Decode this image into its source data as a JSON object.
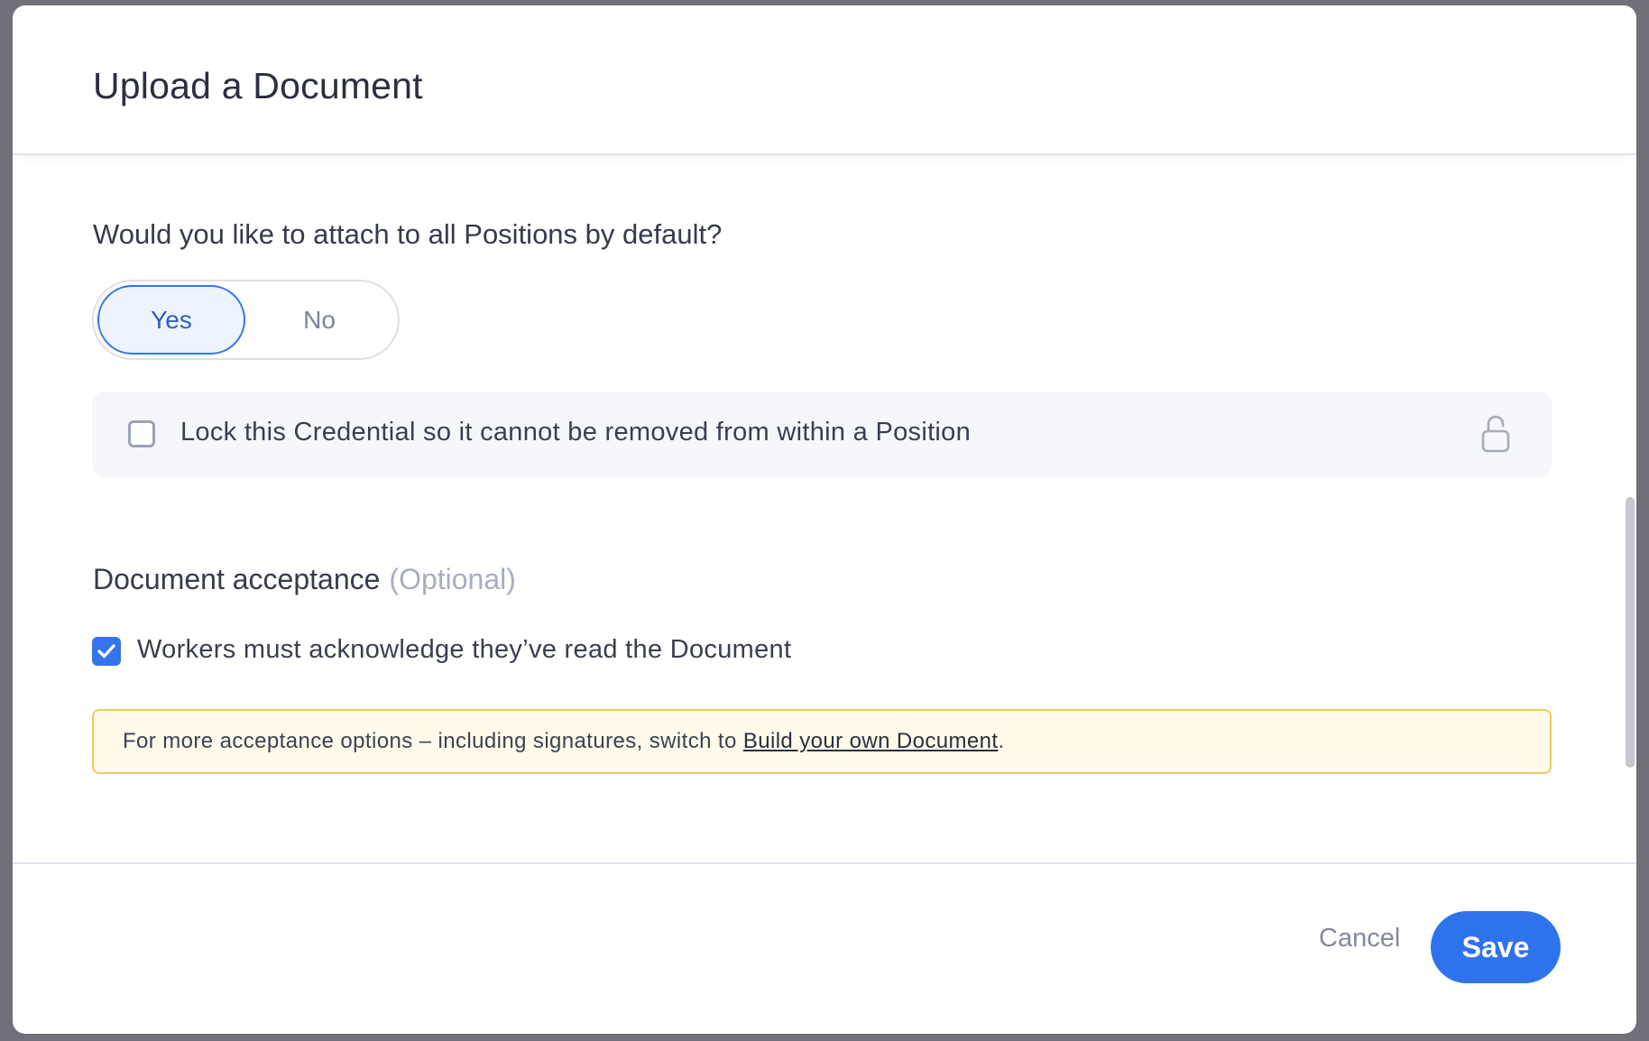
{
  "modal": {
    "title": "Upload a Document"
  },
  "attach": {
    "question": "Would you like to attach to all Positions by default?",
    "options": [
      {
        "label": "Yes",
        "selected": true
      },
      {
        "label": "No",
        "selected": false
      }
    ]
  },
  "lock": {
    "label": "Lock this Credential so it cannot be removed from within a Position",
    "checked": false,
    "icon": "unlock-icon"
  },
  "acceptance": {
    "title": "Document acceptance",
    "optional_tag": "(Optional)",
    "acknowledge_label": "Workers must acknowledge they’ve read the Document",
    "acknowledge_checked": true
  },
  "notice": {
    "text_before": "For more acceptance options – including signatures, switch to ",
    "link": "Build your own Document",
    "text_after": "."
  },
  "footer": {
    "cancel_label": "Cancel",
    "save_label": "Save"
  },
  "colors": {
    "accent": "#2f73ec",
    "notice_bg": "#fffaea",
    "notice_border": "#f3c95b"
  }
}
